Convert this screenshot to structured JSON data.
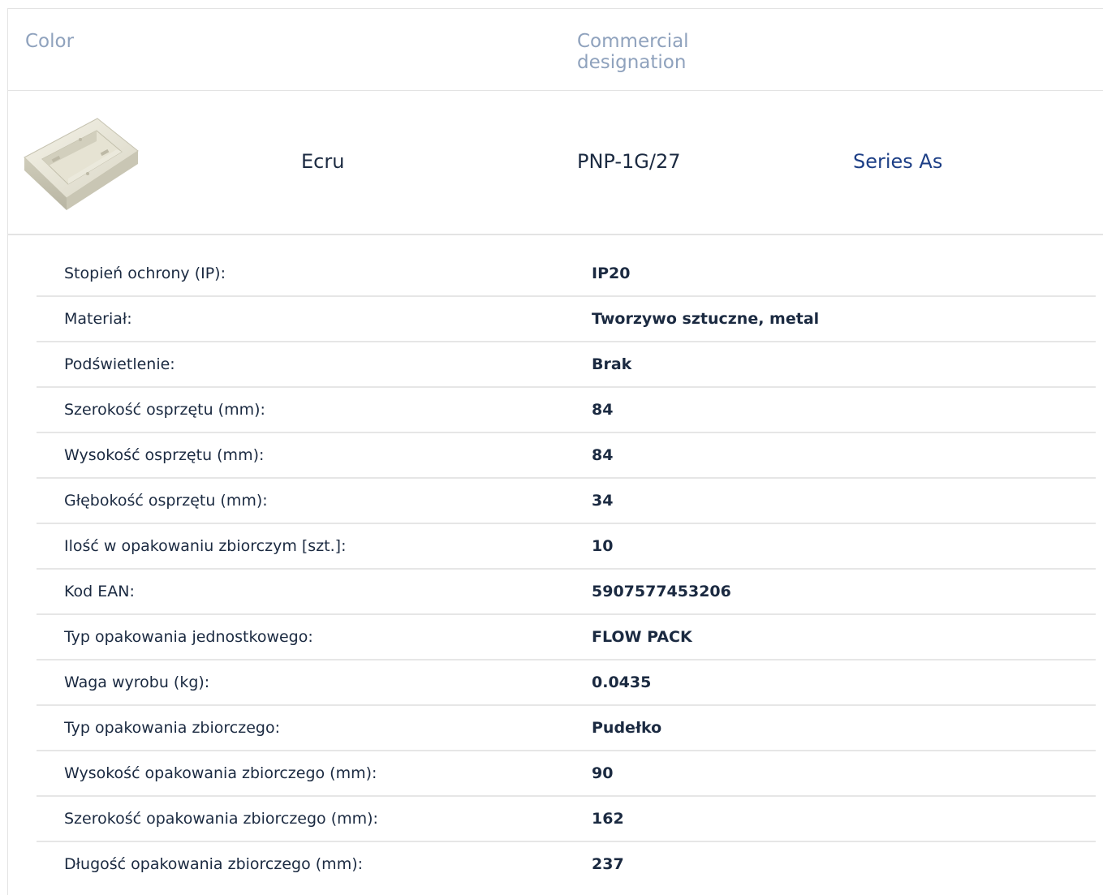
{
  "header": {
    "color_label": "Color",
    "designation_label": "Commercial designation"
  },
  "product": {
    "image_icon": "ecru-surface-box-image",
    "color": "Ecru",
    "code": "PNP-1G/27",
    "series": "Series As",
    "series_color": "#1d3f86"
  },
  "specs": [
    {
      "label": "Stopień ochrony (IP):",
      "value": "IP20"
    },
    {
      "label": "Materiał:",
      "value": "Tworzywo sztuczne, metal"
    },
    {
      "label": "Podświetlenie:",
      "value": "Brak"
    },
    {
      "label": "Szerokość osprzętu (mm):",
      "value": "84"
    },
    {
      "label": "Wysokość osprzętu (mm):",
      "value": "84"
    },
    {
      "label": "Głębokość osprzętu (mm):",
      "value": "34"
    },
    {
      "label": "Ilość w opakowaniu zbiorczym [szt.]:",
      "value": "10"
    },
    {
      "label": "Kod EAN:",
      "value": "5907577453206"
    },
    {
      "label": "Typ opakowania jednostkowego:",
      "value": "FLOW PACK"
    },
    {
      "label": "Waga wyrobu (kg):",
      "value": "0.0435"
    },
    {
      "label": "Typ opakowania zbiorczego:",
      "value": "Pudełko"
    },
    {
      "label": "Wysokość opakowania zbiorczego (mm):",
      "value": "90"
    },
    {
      "label": "Szerokość opakowania zbiorczego (mm):",
      "value": "162"
    },
    {
      "label": "Długość opakowania zbiorczego (mm):",
      "value": "237"
    }
  ]
}
